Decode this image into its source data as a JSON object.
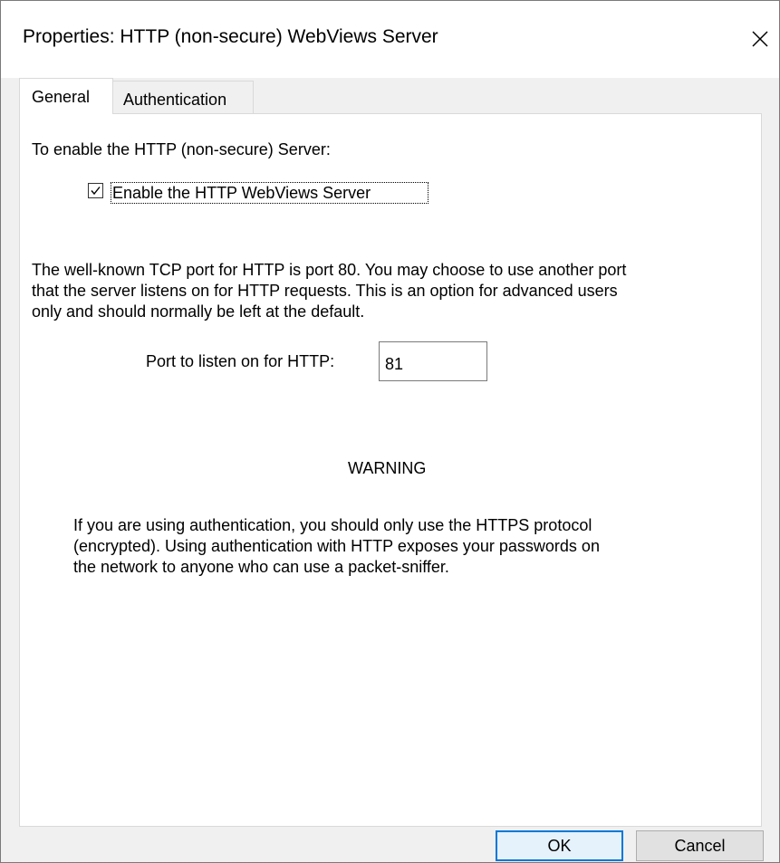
{
  "window": {
    "title": "Properties: HTTP (non-secure) WebViews Server"
  },
  "tabs": [
    {
      "label": "General",
      "active": true
    },
    {
      "label": "Authentication",
      "active": false
    }
  ],
  "general": {
    "enable_intro": "To enable the HTTP (non-secure) Server:",
    "enable_checkbox": {
      "label": "Enable the HTTP WebViews Server",
      "checked": true
    },
    "port_description": [
      "The well-known TCP port for HTTP is port 80. You may choose to use another port",
      "that the server listens on for HTTP requests. This is an option for advanced users",
      "only and should normally be left at the default."
    ],
    "port_label": "Port to listen on for HTTP:",
    "port_value": "81",
    "warning_title": "WARNING",
    "warning_text": [
      "If you are using authentication, you should only use the HTTPS protocol",
      "(encrypted). Using authentication with HTTP exposes your passwords on",
      "the network to anyone who can use a packet-sniffer."
    ]
  },
  "buttons": {
    "ok": "OK",
    "cancel": "Cancel"
  },
  "colors": {
    "accent": "#0078d7",
    "dialog_bg": "#f0f0f0",
    "panel_bg": "#ffffff"
  },
  "icons": {
    "close": "close-icon",
    "check": "checkmark-icon"
  }
}
